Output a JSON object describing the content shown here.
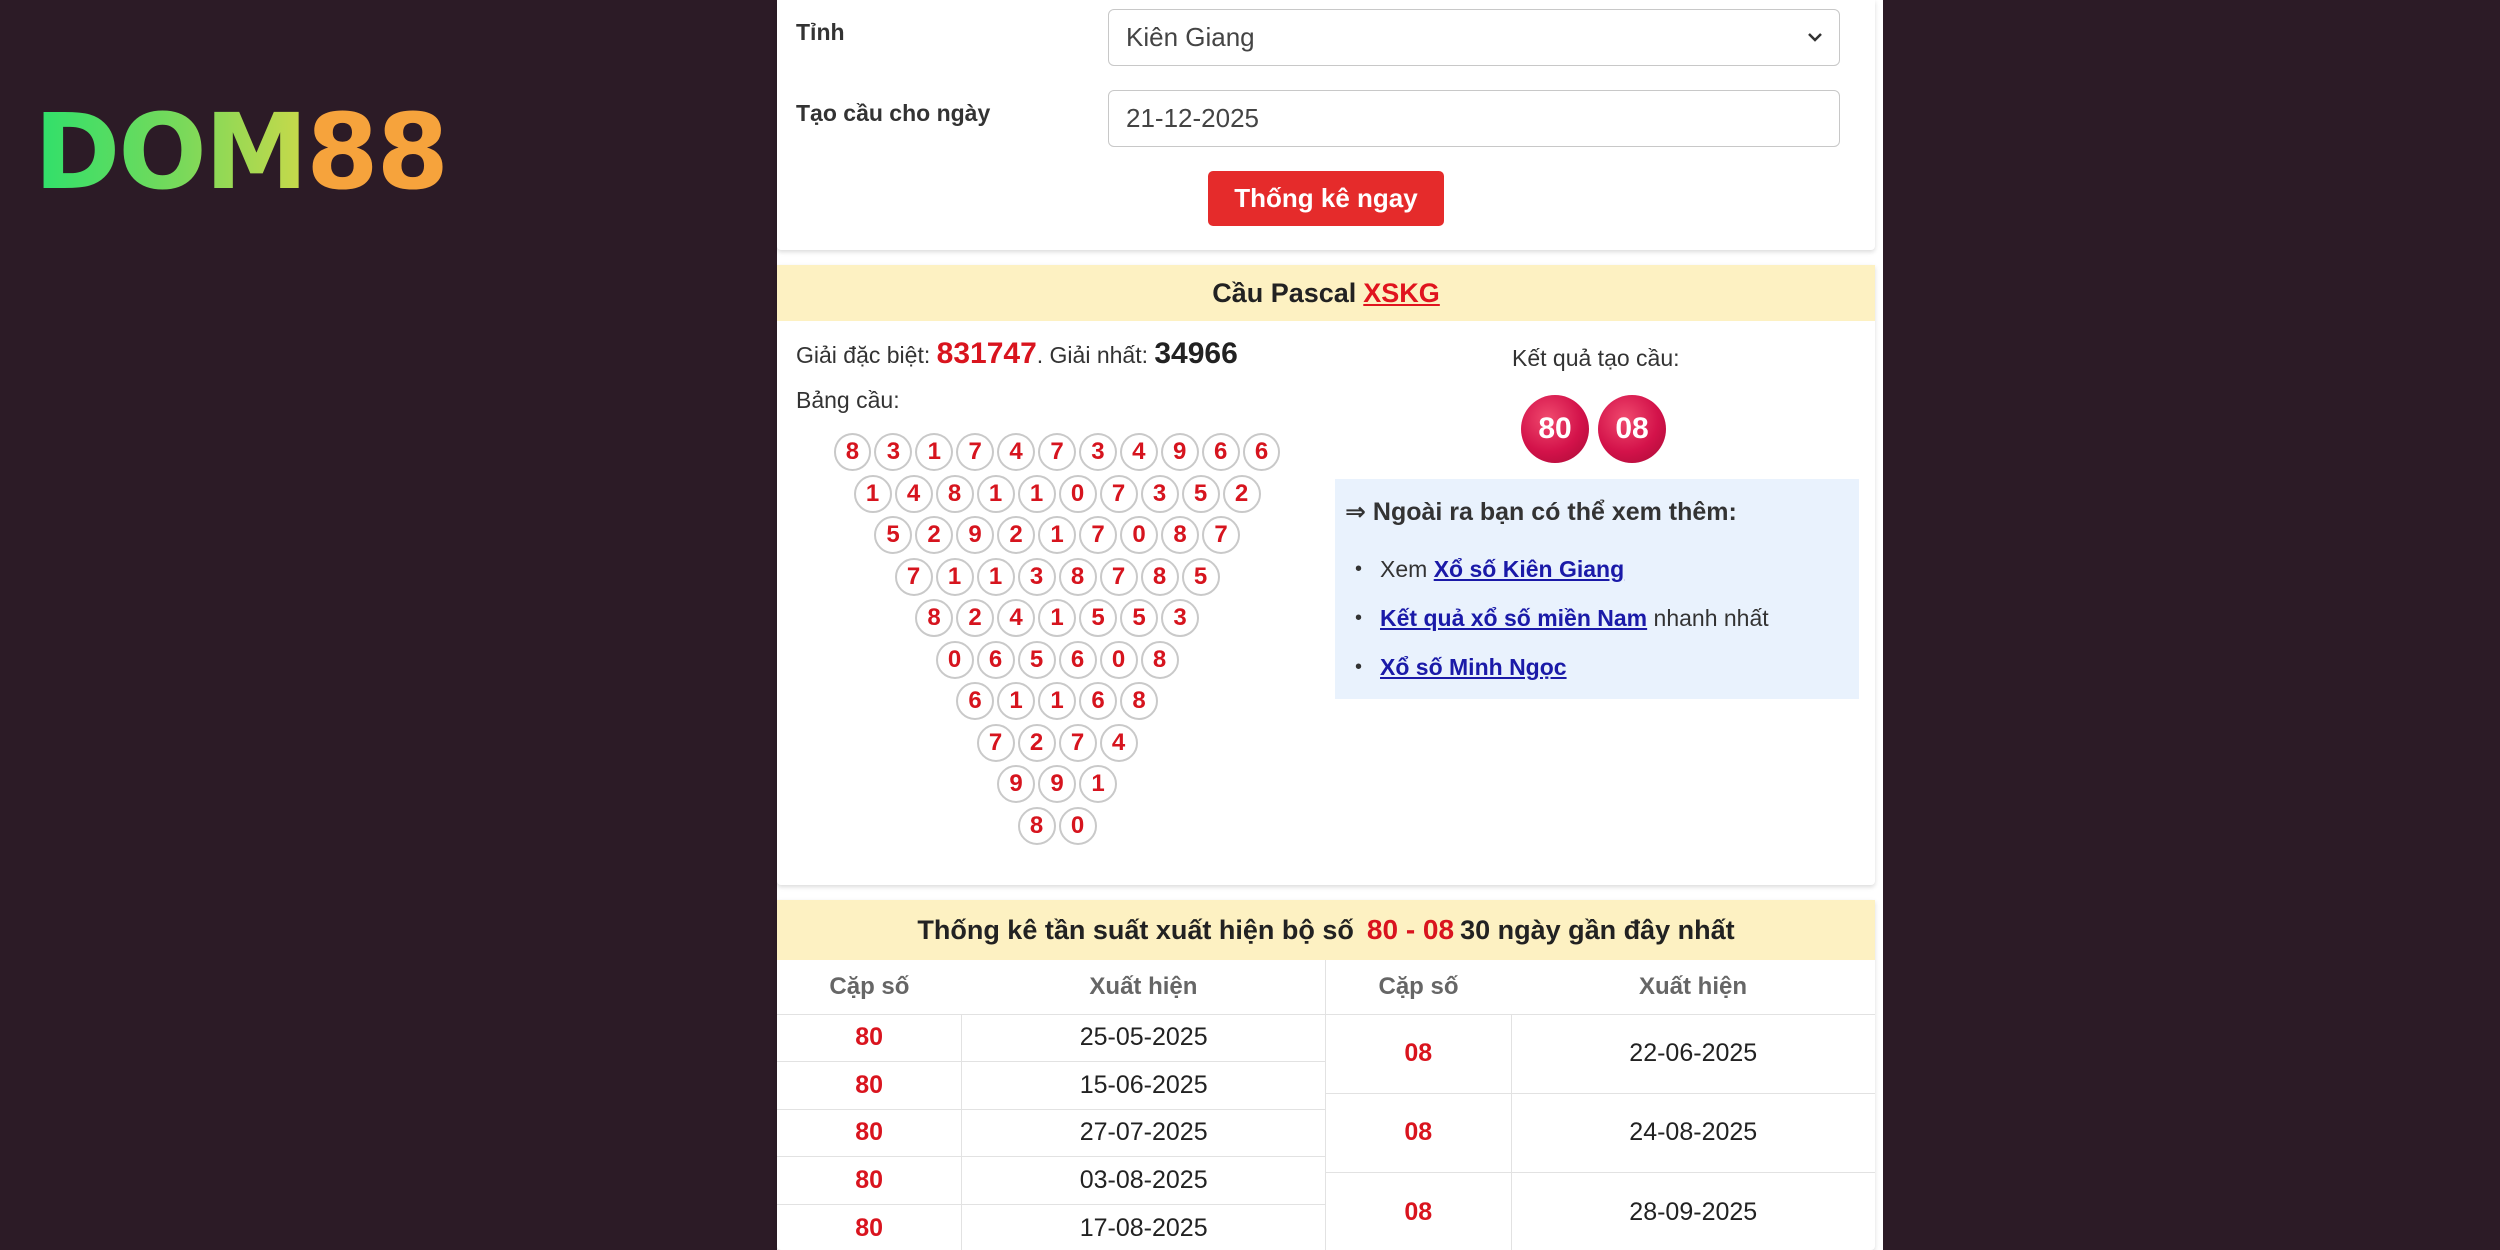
{
  "logo": {
    "part1": "DOM",
    "part2": "88"
  },
  "form": {
    "province_label": "Tỉnh",
    "province_value": "Kiên Giang",
    "date_label": "Tạo cầu cho ngày",
    "date_value": "21-12-2025",
    "submit_label": "Thống kê ngay"
  },
  "pascal": {
    "title": "Cầu Pascal",
    "title_link": "XSKG",
    "special_label": "Giải đặc biệt:",
    "special_value": "831747",
    "first_label": ". Giải nhất:",
    "first_value": "34966",
    "table_label": "Bảng cầu:",
    "rows": [
      [
        "8",
        "3",
        "1",
        "7",
        "4",
        "7",
        "3",
        "4",
        "9",
        "6",
        "6"
      ],
      [
        "1",
        "4",
        "8",
        "1",
        "1",
        "0",
        "7",
        "3",
        "5",
        "2"
      ],
      [
        "5",
        "2",
        "9",
        "2",
        "1",
        "7",
        "0",
        "8",
        "7"
      ],
      [
        "7",
        "1",
        "1",
        "3",
        "8",
        "7",
        "8",
        "5"
      ],
      [
        "8",
        "2",
        "4",
        "1",
        "5",
        "5",
        "3"
      ],
      [
        "0",
        "6",
        "5",
        "6",
        "0",
        "8"
      ],
      [
        "6",
        "1",
        "1",
        "6",
        "8"
      ],
      [
        "7",
        "2",
        "7",
        "4"
      ],
      [
        "9",
        "9",
        "1"
      ],
      [
        "8",
        "0"
      ]
    ],
    "result_label": "Kết quả tạo cầu:",
    "results": [
      "80",
      "08"
    ],
    "more_title": "⇒ Ngoài ra bạn có thể xem thêm:",
    "more_links": [
      {
        "prefix": "Xem ",
        "link": "Xổ số Kiên Giang",
        "suffix": ""
      },
      {
        "prefix": "",
        "link": "Kết quả xổ số miền Nam",
        "suffix": " nhanh nhất"
      },
      {
        "prefix": "",
        "link": "Xổ số Minh Ngọc",
        "suffix": ""
      }
    ]
  },
  "stats": {
    "title_prefix": "Thống kê tần suất xuất hiện bộ số",
    "title_pair": "80 - 08",
    "title_suffix": "30 ngày gần đây nhất",
    "col_pair": "Cặp số",
    "col_appear": "Xuất hiện",
    "left_rows": [
      {
        "pair": "80",
        "date": "25-05-2025"
      },
      {
        "pair": "80",
        "date": "15-06-2025"
      },
      {
        "pair": "80",
        "date": "27-07-2025"
      },
      {
        "pair": "80",
        "date": "03-08-2025"
      },
      {
        "pair": "80",
        "date": "17-08-2025"
      }
    ],
    "right_rows": [
      {
        "pair": "08",
        "date": "22-06-2025"
      },
      {
        "pair": "08",
        "date": "24-08-2025"
      },
      {
        "pair": "08",
        "date": "28-09-2025"
      }
    ]
  }
}
